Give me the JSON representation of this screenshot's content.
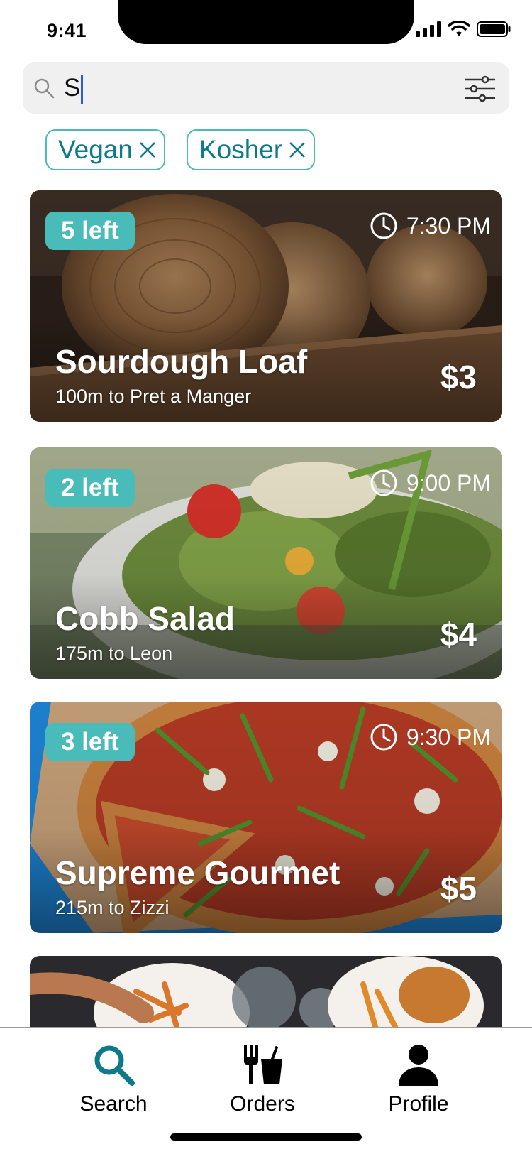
{
  "status_bar": {
    "time": "9:41"
  },
  "search": {
    "query": "S"
  },
  "filters": [
    {
      "label": "Vegan"
    },
    {
      "label": "Kosher"
    }
  ],
  "listings": [
    {
      "badge": "5 left",
      "time": "7:30 PM",
      "title": "Sourdough Loaf",
      "distance": "100m to Pret a Manger",
      "price": "$3"
    },
    {
      "badge": "2 left",
      "time": "9:00 PM",
      "title": "Cobb Salad",
      "distance": "175m to Leon",
      "price": "$4"
    },
    {
      "badge": "3 left",
      "time": "9:30 PM",
      "title": "Supreme Gourmet",
      "distance": "215m to Zizzi",
      "price": "$5"
    }
  ],
  "tabs": [
    {
      "label": "Search",
      "icon": "search-icon",
      "active": true
    },
    {
      "label": "Orders",
      "icon": "fork-cup-icon",
      "active": false
    },
    {
      "label": "Profile",
      "icon": "person-icon",
      "active": false
    }
  ],
  "colors": {
    "accent": "#49bcb9",
    "accent_dark": "#0d7a8a"
  }
}
